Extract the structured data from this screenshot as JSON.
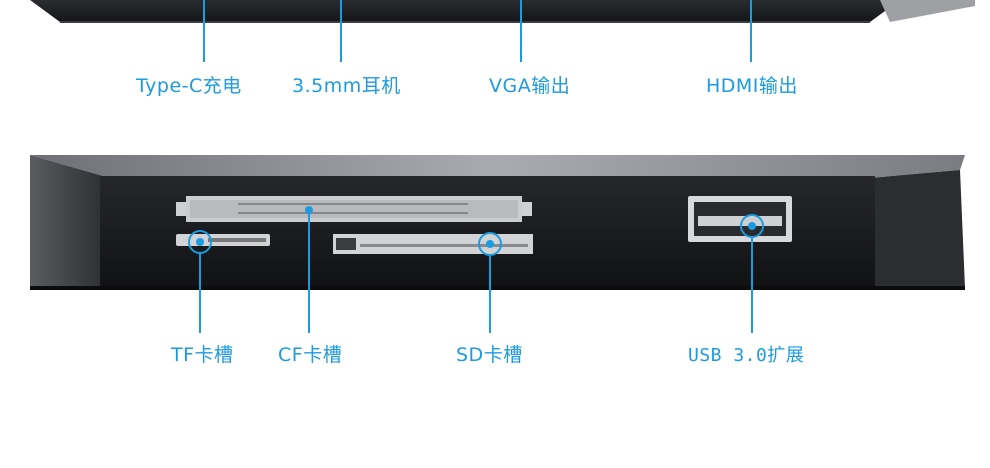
{
  "accent_color": "#1d9be0",
  "device_color": "#1c1d20",
  "top_ports": [
    {
      "label": "Type-C充电",
      "icon": "type-c-port"
    },
    {
      "label": "3.5mm耳机",
      "icon": "audio-jack-port"
    },
    {
      "label": "VGA输出",
      "icon": "vga-port"
    },
    {
      "label": "HDMI输出",
      "icon": "hdmi-port"
    }
  ],
  "bottom_ports": [
    {
      "label": "TF卡槽",
      "icon": "tf-card-slot"
    },
    {
      "label": "CF卡槽",
      "icon": "cf-card-slot"
    },
    {
      "label": "SD卡槽",
      "icon": "sd-card-slot"
    },
    {
      "label": "USB 3.0扩展",
      "icon": "usb-port"
    }
  ]
}
